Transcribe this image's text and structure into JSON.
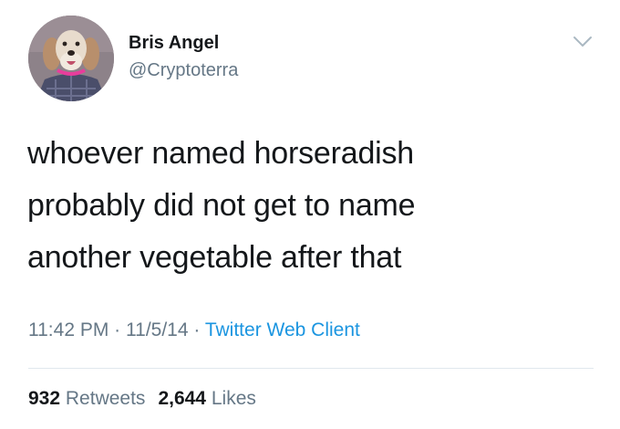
{
  "user": {
    "name": "Bris Angel",
    "handle": "@Cryptoterra"
  },
  "tweet": {
    "lines": [
      "whoever named horseradish",
      "probably did not get to name",
      "another vegetable after that"
    ]
  },
  "meta": {
    "time": "11:42 PM",
    "sep1": "·",
    "date": "11/5/14",
    "sep2": "·",
    "client": "Twitter Web Client"
  },
  "stats": {
    "retweets_count": "932",
    "retweets_label": "Retweets",
    "likes_count": "2,644",
    "likes_label": "Likes"
  },
  "icons": {
    "menu": "chevron-down-icon"
  },
  "colors": {
    "text": "#14171a",
    "secondary": "#657786",
    "link": "#1b95e0",
    "divider": "#e1e8ed"
  }
}
